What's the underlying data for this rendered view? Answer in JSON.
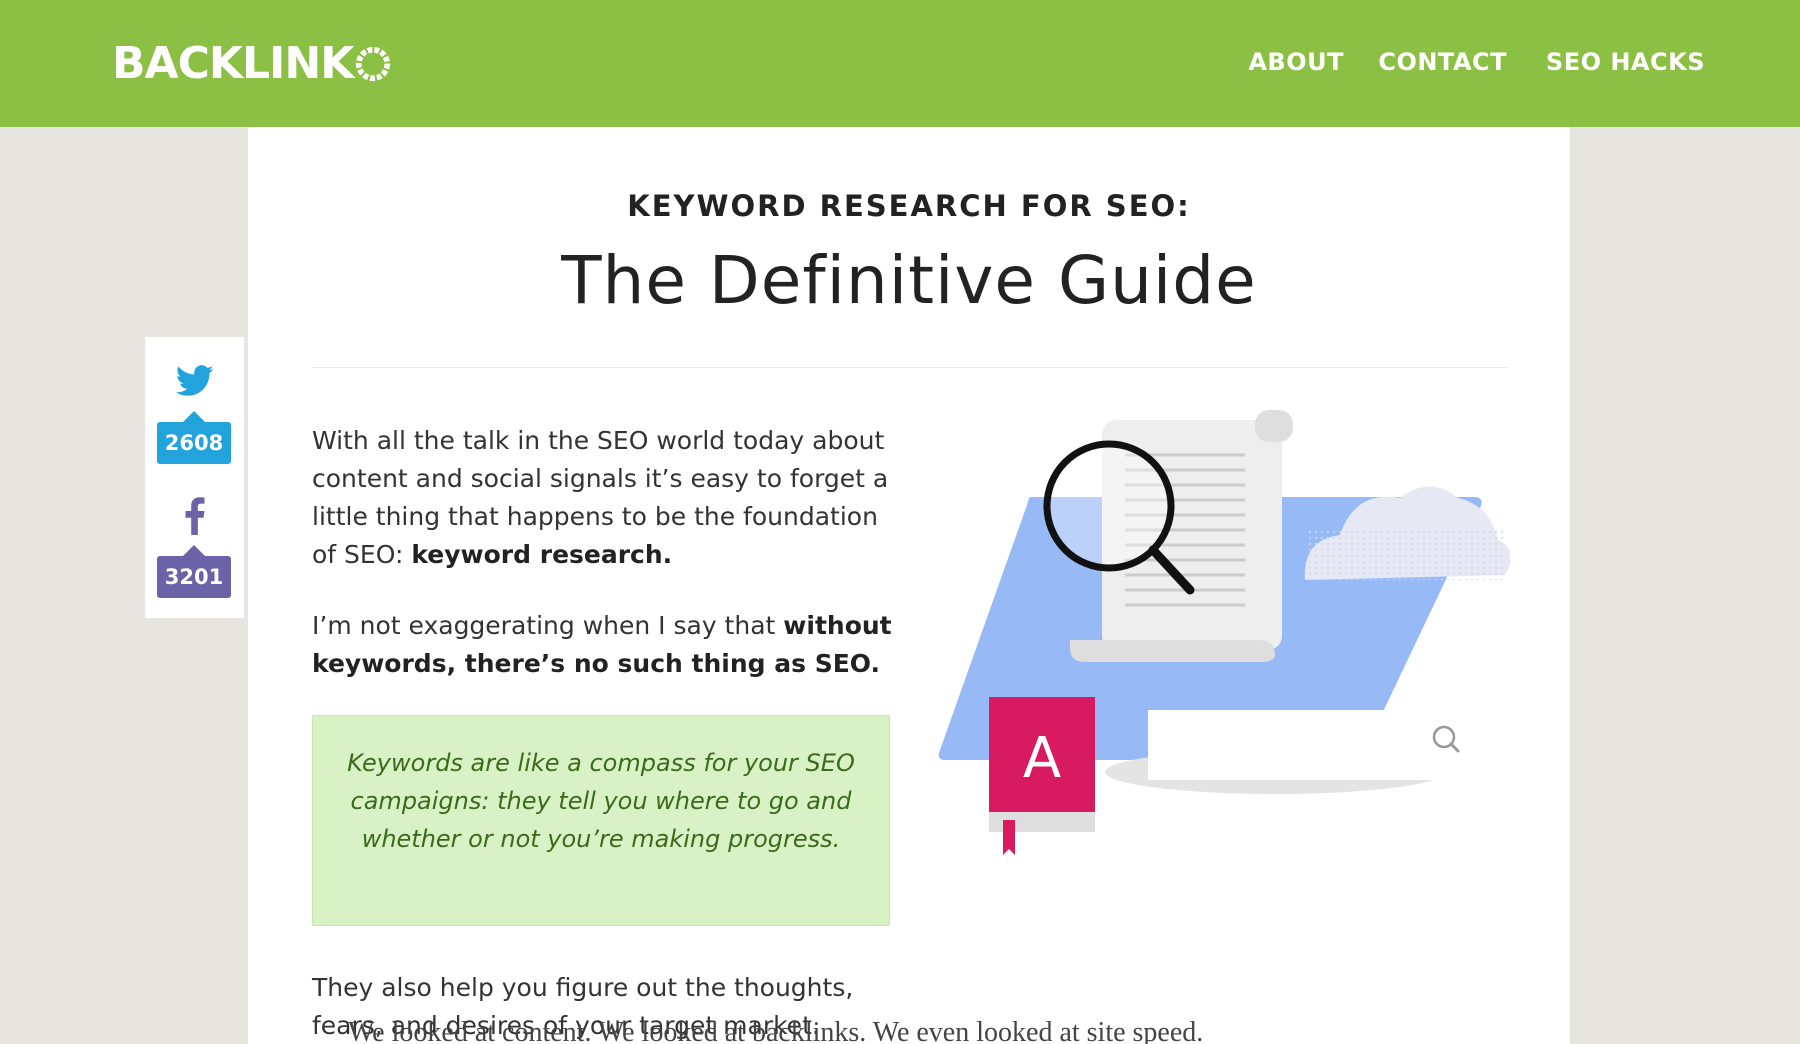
{
  "header": {
    "logo_text": "BACKLINK",
    "brand_color": "#8cc045",
    "nav": [
      {
        "label": "ABOUT"
      },
      {
        "label": "CONTACT"
      },
      {
        "label": "SEO HACKS"
      }
    ]
  },
  "article": {
    "eyebrow": "KEYWORD RESEARCH FOR SEO:",
    "title": "The Definitive Guide",
    "p1_start": "With all the talk in the SEO world today about content and social signals it’s easy to forget a little thing that happens to be the foundation of SEO: ",
    "p1_bold": "keyword research.",
    "p2_start": "I’m not exaggerating when I say that ",
    "p2_bold": "without keywords, there’s no such thing as SEO.",
    "quote": "Keywords are like a compass for your SEO campaigns: they tell you where to go and whether or not you’re making progress.",
    "p3": "They also help you figure out the thoughts, fears, and desires of your target market.",
    "overlap_text": "We looked at content. We looked at backlinks. We even looked at site speed."
  },
  "share": {
    "twitter_count": "2608",
    "facebook_count": "3201",
    "twitter_color": "#22a3dc",
    "facebook_color": "#6c62a8"
  },
  "illustration": {
    "book_letter": "A"
  }
}
